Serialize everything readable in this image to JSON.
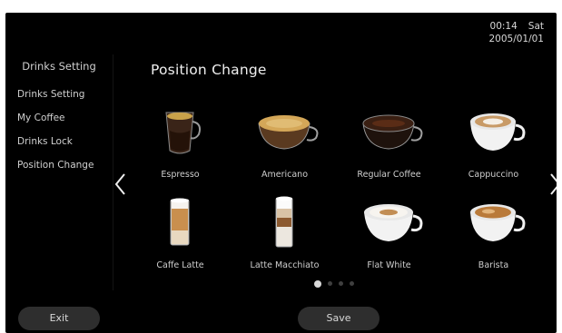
{
  "clock": {
    "time": "00:14",
    "day": "Sat",
    "date": "2005/01/01"
  },
  "sidebar": {
    "title": "Drinks Setting",
    "items": [
      {
        "label": "Drinks Setting"
      },
      {
        "label": "My Coffee"
      },
      {
        "label": "Drinks Lock"
      },
      {
        "label": "Position Change"
      }
    ]
  },
  "main": {
    "title": "Position Change",
    "drinks": [
      {
        "label": "Espresso",
        "icon": "espresso-glass-icon"
      },
      {
        "label": "Americano",
        "icon": "americano-cup-icon"
      },
      {
        "label": "Regular Coffee",
        "icon": "regular-coffee-cup-icon"
      },
      {
        "label": "Cappuccino",
        "icon": "cappuccino-cup-icon"
      },
      {
        "label": "Caffe Latte",
        "icon": "caffe-latte-glass-icon"
      },
      {
        "label": "Latte Macchiato",
        "icon": "latte-macchiato-glass-icon"
      },
      {
        "label": "Flat White",
        "icon": "flat-white-cup-icon"
      },
      {
        "label": "Barista",
        "icon": "barista-cup-icon"
      }
    ],
    "pagination": {
      "pages": 4,
      "current": 1
    }
  },
  "buttons": {
    "exit_label": "Exit",
    "save_label": "Save"
  },
  "colors": {
    "background": "#000000",
    "text": "#e6e6e6",
    "button": "#2e2e2e"
  }
}
